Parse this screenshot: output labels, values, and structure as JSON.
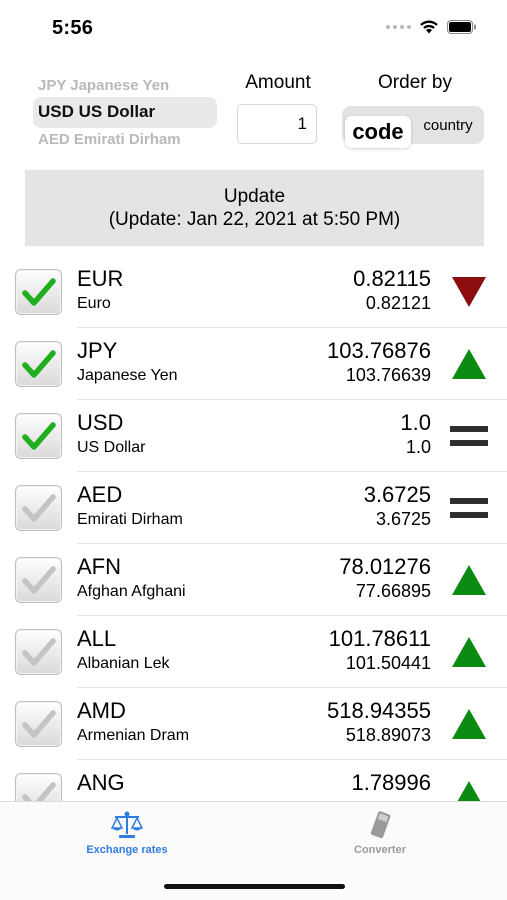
{
  "status_bar": {
    "time": "5:56"
  },
  "currency_picker": {
    "options": [
      "JPY Japanese Yen",
      "USD US Dollar",
      "AED Emirati Dirham"
    ],
    "selected_index": 1
  },
  "amount": {
    "label": "Amount",
    "value": "1"
  },
  "order_by": {
    "label": "Order by",
    "options": [
      "code",
      "country"
    ],
    "selected": "code"
  },
  "update_button": {
    "title": "Update",
    "subtitle": "(Update: Jan 22, 2021 at 5:50 PM)"
  },
  "colors": {
    "trend_up": "#0a8a10",
    "trend_down": "#8c0d0d",
    "equal": "#2f2f2f",
    "tab_active": "#2f7de1",
    "tab_inactive": "#9a9a9a"
  },
  "rates": [
    {
      "code": "EUR",
      "name": "Euro",
      "rate": "0.82115",
      "previous": "0.82121",
      "checked": true,
      "trend": "down"
    },
    {
      "code": "JPY",
      "name": "Japanese Yen",
      "rate": "103.76876",
      "previous": "103.76639",
      "checked": true,
      "trend": "up"
    },
    {
      "code": "USD",
      "name": "US Dollar",
      "rate": "1.0",
      "previous": "1.0",
      "checked": true,
      "trend": "equal"
    },
    {
      "code": "AED",
      "name": "Emirati Dirham",
      "rate": "3.6725",
      "previous": "3.6725",
      "checked": false,
      "trend": "equal"
    },
    {
      "code": "AFN",
      "name": "Afghan Afghani",
      "rate": "78.01276",
      "previous": "77.66895",
      "checked": false,
      "trend": "up"
    },
    {
      "code": "ALL",
      "name": "Albanian Lek",
      "rate": "101.78611",
      "previous": "101.50441",
      "checked": false,
      "trend": "up"
    },
    {
      "code": "AMD",
      "name": "Armenian Dram",
      "rate": "518.94355",
      "previous": "518.89073",
      "checked": false,
      "trend": "up"
    },
    {
      "code": "ANG",
      "name": "",
      "rate": "1.78996",
      "previous": "",
      "checked": false,
      "trend": "up"
    }
  ],
  "tab_bar": {
    "tabs": [
      {
        "label": "Exchange rates",
        "icon": "scales-icon",
        "active": true
      },
      {
        "label": "Converter",
        "icon": "converter-icon",
        "active": false
      }
    ]
  }
}
